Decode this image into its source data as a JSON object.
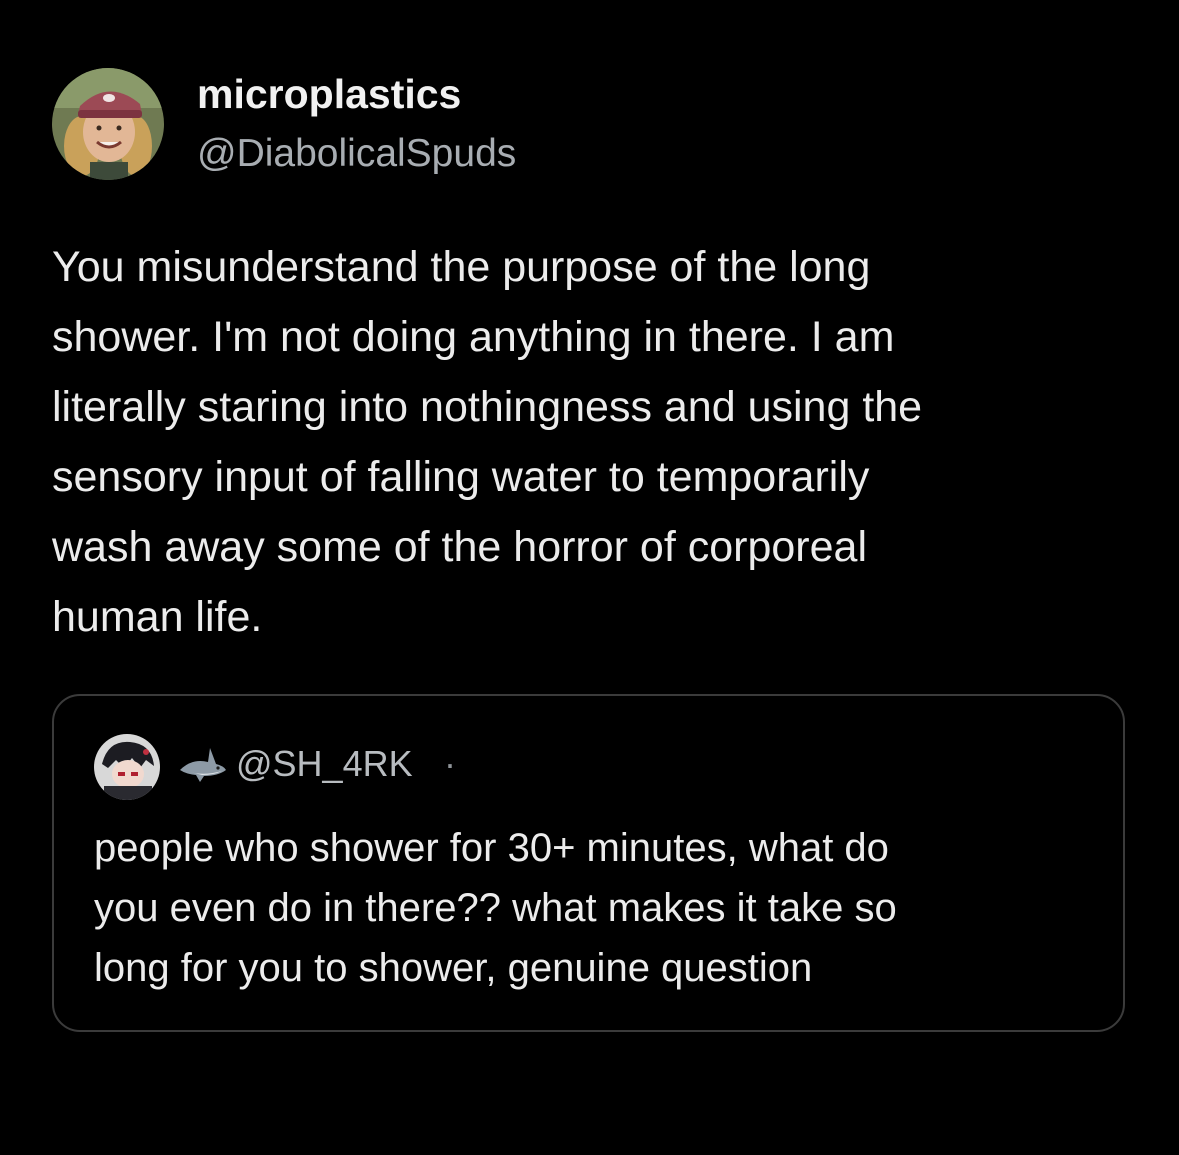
{
  "tweet": {
    "display_name": "microplastics",
    "handle": "@DiabolicalSpuds",
    "avatar_icon": "profile-photo-man-with-cap",
    "body_lines": [
      "You misunderstand the purpose of the long",
      "shower. I'm not doing anything in there. I am",
      "literally staring into nothingness and using the",
      "sensory input of falling water to temporarily",
      "wash away some of the horror of corporeal",
      "human life."
    ]
  },
  "quoted_tweet": {
    "handle": "@SH_4RK",
    "separator": "·",
    "avatar_icon": "profile-photo-anime-character",
    "badge_icon": "shark-icon",
    "body_lines": [
      "people who shower for 30+ minutes, what do",
      "you even do in there?? what makes it take so",
      "long for you to shower, genuine question"
    ]
  },
  "colors": {
    "background": "#000000",
    "text_primary": "#ececec",
    "text_secondary": "#a8adb2",
    "card_border": "#3b3b3b"
  }
}
